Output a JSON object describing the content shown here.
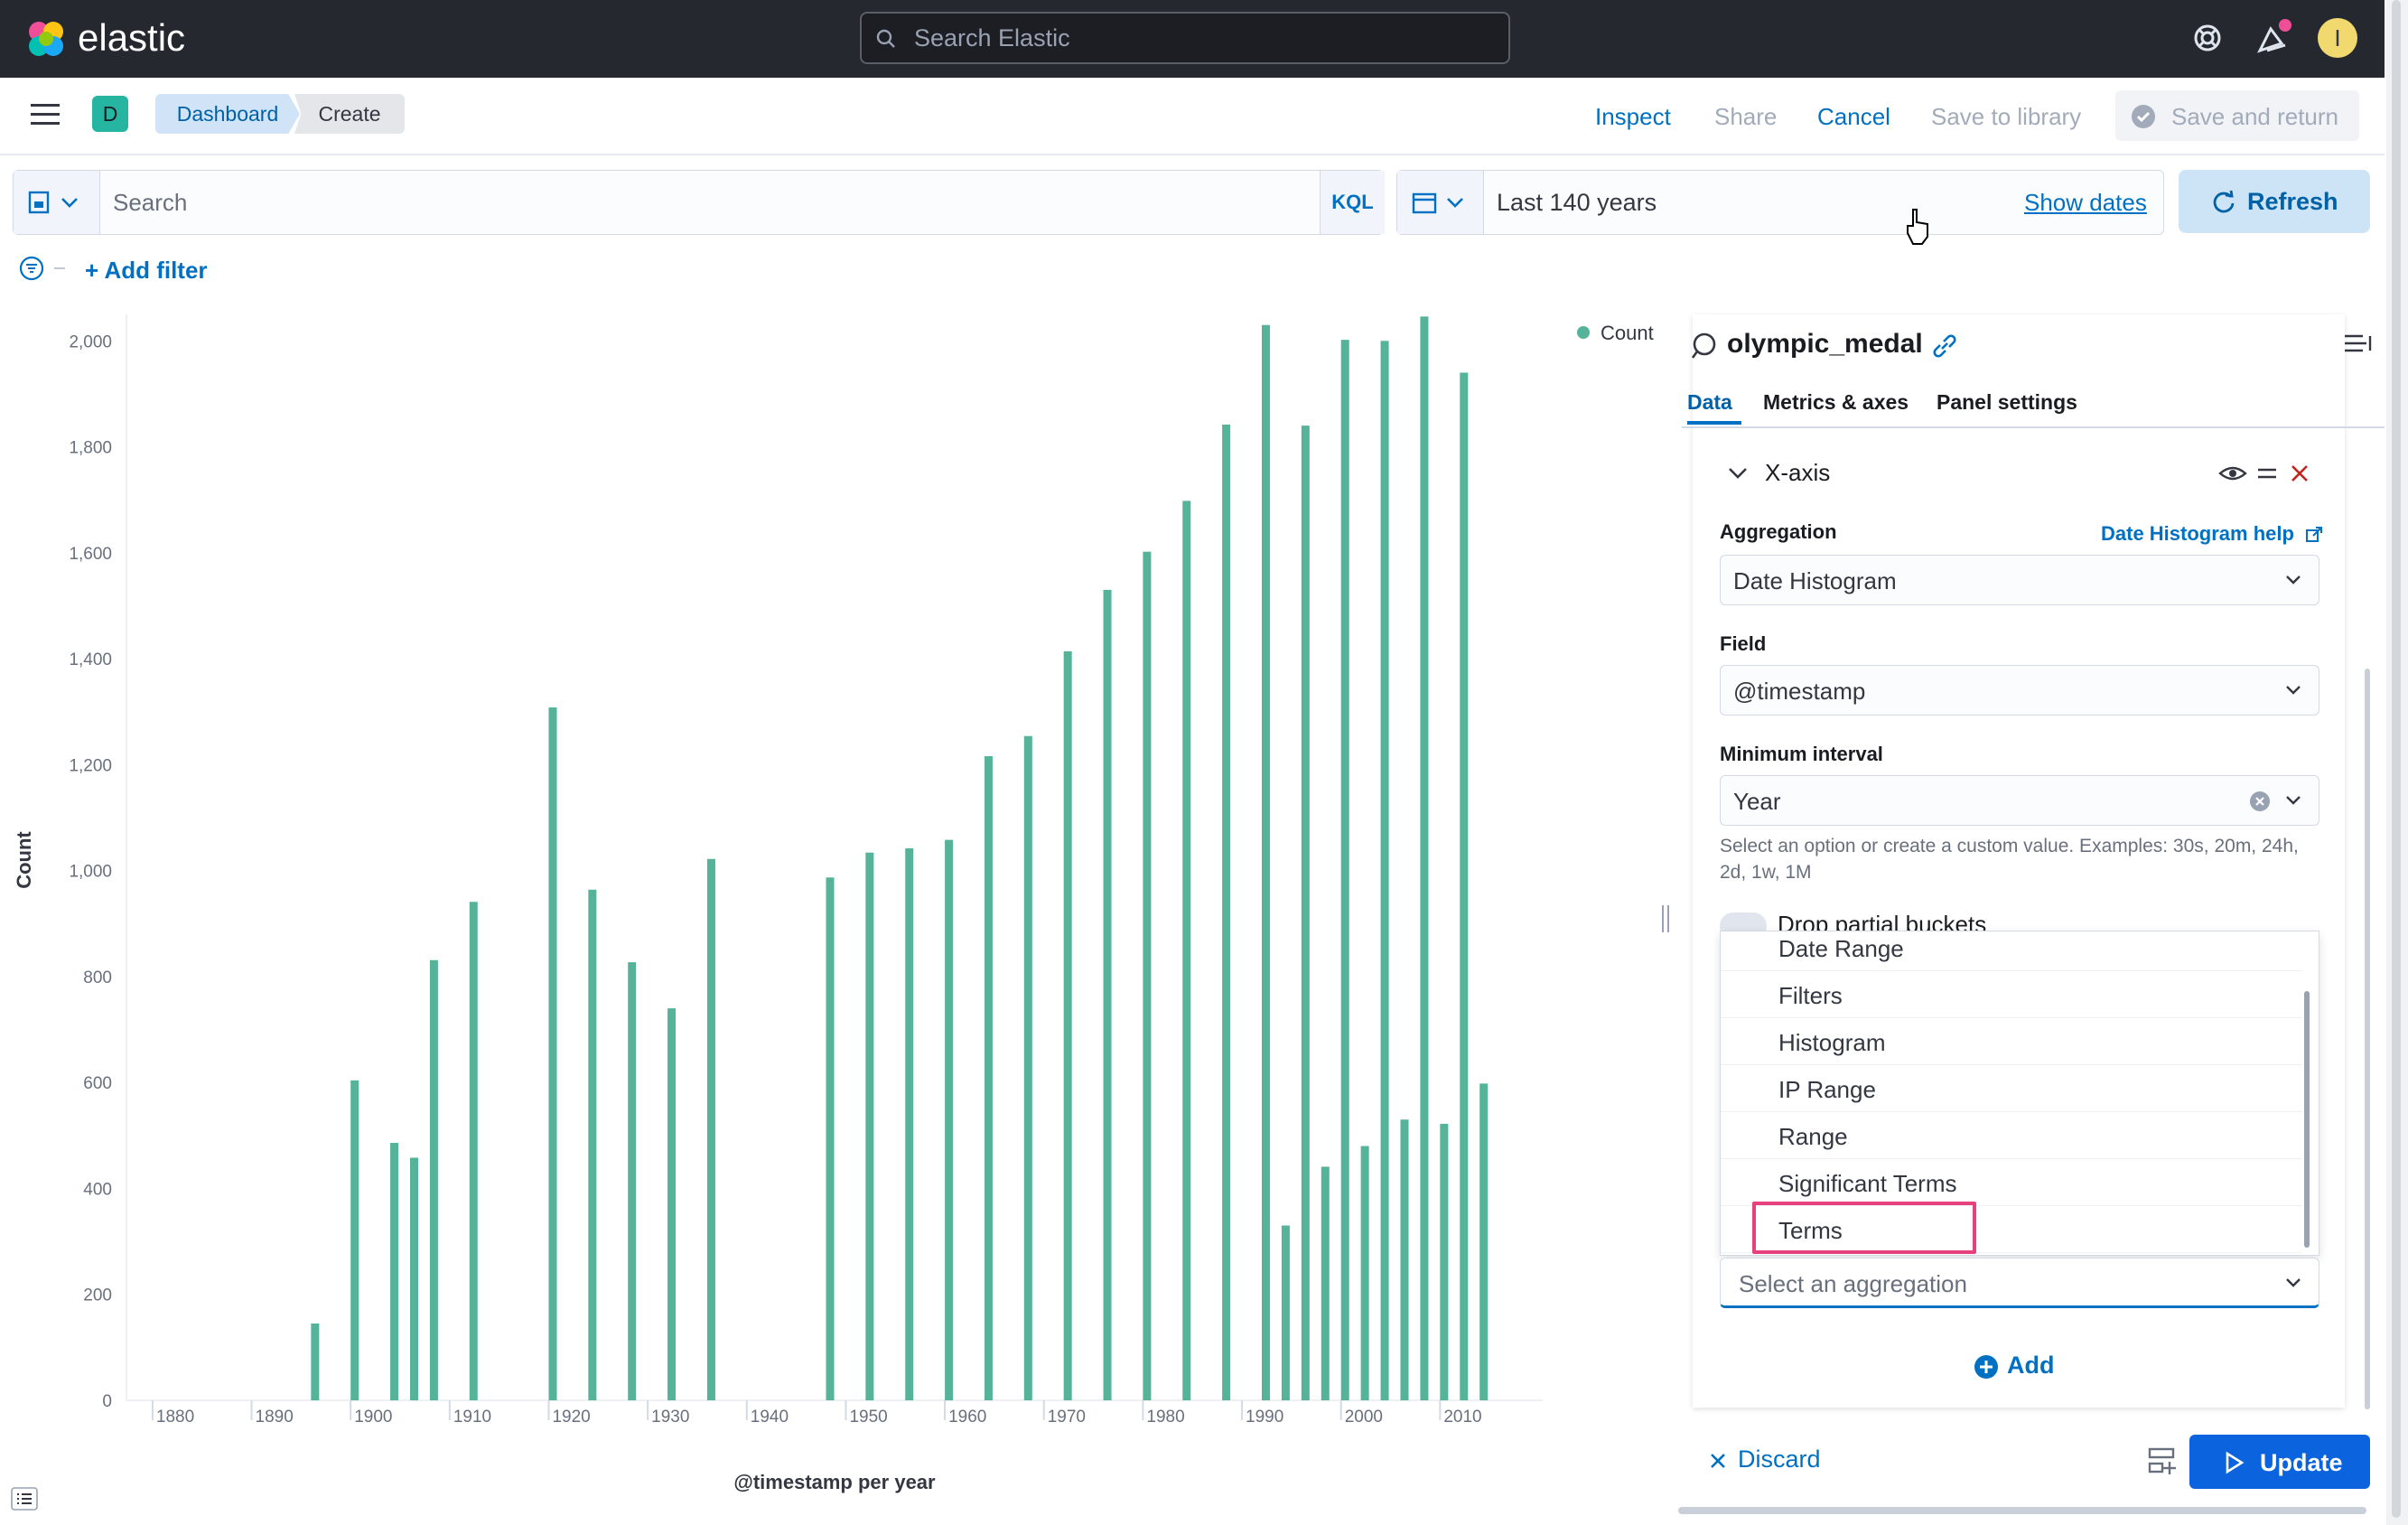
{
  "header": {
    "brand": "elastic",
    "search_placeholder": "Search Elastic",
    "avatar_letter": "I"
  },
  "nav": {
    "space_letter": "D",
    "breadcrumbs": [
      "Dashboard",
      "Create"
    ],
    "actions": {
      "inspect": "Inspect",
      "share": "Share",
      "cancel": "Cancel",
      "save_library": "Save to library",
      "save_return": "Save and return"
    }
  },
  "query": {
    "search_placeholder": "Search",
    "language": "KQL",
    "time_range": "Last 140 years",
    "show_dates": "Show dates",
    "refresh": "Refresh",
    "add_filter": "+ Add filter"
  },
  "chart_data": {
    "type": "bar",
    "ylabel": "Count",
    "xlabel": "@timestamp per year",
    "legend": [
      "Count"
    ],
    "legend_position": "top-right",
    "xlim": [
      1877,
      2020
    ],
    "ylim": [
      0,
      2050
    ],
    "x_ticks": [
      1880,
      1890,
      1900,
      1910,
      1920,
      1930,
      1940,
      1950,
      1960,
      1970,
      1980,
      1990,
      2000,
      2010
    ],
    "y_ticks": [
      0,
      200,
      400,
      600,
      800,
      1000,
      1200,
      1400,
      1600,
      1800,
      2000
    ],
    "y_tick_labels": [
      "0",
      "200",
      "400",
      "600",
      "800",
      "1,000",
      "1,200",
      "1,400",
      "1,600",
      "1,800",
      "2,000"
    ],
    "color": "#54b399",
    "x": [
      1896,
      1900,
      1904,
      1906,
      1908,
      1912,
      1920,
      1924,
      1928,
      1932,
      1936,
      1948,
      1952,
      1956,
      1960,
      1964,
      1968,
      1972,
      1976,
      1980,
      1984,
      1988,
      1992,
      1994,
      1996,
      1998,
      2000,
      2002,
      2004,
      2006,
      2008,
      2010,
      2012,
      2014
    ],
    "values": [
      145,
      604,
      486,
      458,
      831,
      941,
      1308,
      964,
      827,
      740,
      1022,
      987,
      1034,
      1042,
      1058,
      1216,
      1254,
      1414,
      1530,
      1602,
      1698,
      1842,
      2030,
      330,
      1840,
      441,
      2002,
      480,
      2000,
      530,
      2046,
      522,
      1940,
      598
    ]
  },
  "panel": {
    "index_pattern": "olympic_medal",
    "tabs": [
      "Data",
      "Metrics & axes",
      "Panel settings"
    ],
    "section_title": "X-axis",
    "aggregation_label": "Aggregation",
    "aggregation_help": "Date Histogram help",
    "aggregation_value": "Date Histogram",
    "field_label": "Field",
    "field_value": "@timestamp",
    "interval_label": "Minimum interval",
    "interval_value": "Year",
    "interval_help": "Select an option or create a custom value. Examples: 30s, 20m, 24h, 2d, 1w, 1M",
    "drop_partial": "Drop partial buckets",
    "dropdown_items": [
      "Date Range",
      "Filters",
      "Histogram",
      "IP Range",
      "Range",
      "Significant Terms",
      "Terms"
    ],
    "select_placeholder": "Select an aggregation",
    "add": "Add",
    "discard": "Discard",
    "update": "Update"
  }
}
